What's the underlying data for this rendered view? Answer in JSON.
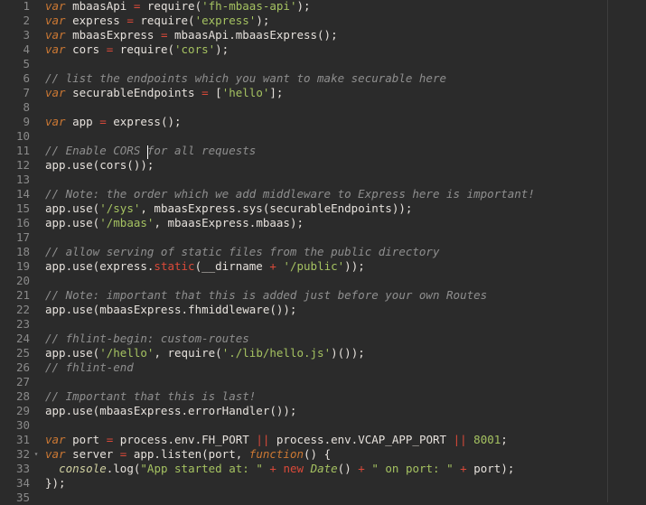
{
  "editor": {
    "theme": {
      "background": "#2b2b2b",
      "keyword": "#cc7833",
      "string": "#a5c261",
      "operator": "#da4939",
      "comment": "#b0b0b0"
    },
    "fold_icon": "fold-triangle-down-icon",
    "lines": [
      {
        "n": "1",
        "tokens": [
          [
            "kw",
            "var"
          ],
          [
            "t",
            " mbaasApi "
          ],
          [
            "op",
            "="
          ],
          [
            "t",
            " require("
          ],
          [
            "str",
            "'fh-mbaas-api'"
          ],
          [
            "t",
            ");"
          ]
        ]
      },
      {
        "n": "2",
        "tokens": [
          [
            "kw",
            "var"
          ],
          [
            "t",
            " express "
          ],
          [
            "op",
            "="
          ],
          [
            "t",
            " require("
          ],
          [
            "str",
            "'express'"
          ],
          [
            "t",
            ");"
          ]
        ]
      },
      {
        "n": "3",
        "tokens": [
          [
            "kw",
            "var"
          ],
          [
            "t",
            " mbaasExpress "
          ],
          [
            "op",
            "="
          ],
          [
            "t",
            " mbaasApi.mbaasExpress();"
          ]
        ]
      },
      {
        "n": "4",
        "tokens": [
          [
            "kw",
            "var"
          ],
          [
            "t",
            " cors "
          ],
          [
            "op",
            "="
          ],
          [
            "t",
            " require("
          ],
          [
            "str",
            "'cors'"
          ],
          [
            "t",
            ");"
          ]
        ]
      },
      {
        "n": "5",
        "tokens": []
      },
      {
        "n": "6",
        "tokens": [
          [
            "cm",
            "// list the endpoints which you want to make securable here"
          ]
        ]
      },
      {
        "n": "7",
        "tokens": [
          [
            "kw",
            "var"
          ],
          [
            "t",
            " securableEndpoints "
          ],
          [
            "op",
            "="
          ],
          [
            "t",
            " ["
          ],
          [
            "str",
            "'hello'"
          ],
          [
            "t",
            "];"
          ]
        ]
      },
      {
        "n": "8",
        "tokens": []
      },
      {
        "n": "9",
        "tokens": [
          [
            "kw",
            "var"
          ],
          [
            "t",
            " app "
          ],
          [
            "op",
            "="
          ],
          [
            "t",
            " express();"
          ]
        ]
      },
      {
        "n": "10",
        "tokens": []
      },
      {
        "n": "11",
        "tokens": [
          [
            "cm",
            "// Enable CORS for all requests"
          ]
        ]
      },
      {
        "n": "12",
        "tokens": [
          [
            "t",
            "app.use(cors());"
          ]
        ]
      },
      {
        "n": "13",
        "tokens": []
      },
      {
        "n": "14",
        "tokens": [
          [
            "cm",
            "// Note: the order which we add middleware to Express here is important!"
          ]
        ]
      },
      {
        "n": "15",
        "tokens": [
          [
            "t",
            "app.use("
          ],
          [
            "str",
            "'/sys'"
          ],
          [
            "t",
            ", mbaasExpress.sys(securableEndpoints));"
          ]
        ]
      },
      {
        "n": "16",
        "tokens": [
          [
            "t",
            "app.use("
          ],
          [
            "str",
            "'/mbaas'"
          ],
          [
            "t",
            ", mbaasExpress.mbaas);"
          ]
        ]
      },
      {
        "n": "17",
        "tokens": []
      },
      {
        "n": "18",
        "tokens": [
          [
            "cm",
            "// allow serving of static files from the public directory"
          ]
        ]
      },
      {
        "n": "19",
        "tokens": [
          [
            "t",
            "app.use(express."
          ],
          [
            "op",
            "static"
          ],
          [
            "t",
            "(__dirname "
          ],
          [
            "op",
            "+"
          ],
          [
            "t",
            " "
          ],
          [
            "str",
            "'/public'"
          ],
          [
            "t",
            "));"
          ]
        ]
      },
      {
        "n": "20",
        "tokens": []
      },
      {
        "n": "21",
        "tokens": [
          [
            "cm",
            "// Note: important that this is added just before your own Routes"
          ]
        ]
      },
      {
        "n": "22",
        "tokens": [
          [
            "t",
            "app.use(mbaasExpress.fhmiddleware());"
          ]
        ]
      },
      {
        "n": "23",
        "tokens": []
      },
      {
        "n": "24",
        "tokens": [
          [
            "cm",
            "// fhlint-begin: custom-routes"
          ]
        ]
      },
      {
        "n": "25",
        "tokens": [
          [
            "t",
            "app.use("
          ],
          [
            "str",
            "'/hello'"
          ],
          [
            "t",
            ", require("
          ],
          [
            "str",
            "'./lib/hello.js'"
          ],
          [
            "t",
            ")());"
          ]
        ]
      },
      {
        "n": "26",
        "tokens": [
          [
            "cm",
            "// fhlint-end"
          ]
        ]
      },
      {
        "n": "27",
        "tokens": []
      },
      {
        "n": "28",
        "tokens": [
          [
            "cm",
            "// Important that this is last!"
          ]
        ]
      },
      {
        "n": "29",
        "tokens": [
          [
            "t",
            "app.use(mbaasExpress.errorHandler());"
          ]
        ]
      },
      {
        "n": "30",
        "tokens": []
      },
      {
        "n": "31",
        "tokens": [
          [
            "kw",
            "var"
          ],
          [
            "t",
            " port "
          ],
          [
            "op",
            "="
          ],
          [
            "t",
            " process.env.FH_PORT "
          ],
          [
            "op",
            "||"
          ],
          [
            "t",
            " process.env.VCAP_APP_PORT "
          ],
          [
            "op",
            "||"
          ],
          [
            "t",
            " "
          ],
          [
            "num",
            "8001"
          ],
          [
            "t",
            ";"
          ]
        ]
      },
      {
        "n": "32",
        "fold": true,
        "tokens": [
          [
            "kw",
            "var"
          ],
          [
            "t",
            " server "
          ],
          [
            "op",
            "="
          ],
          [
            "t",
            " app.listen(port, "
          ],
          [
            "fn",
            "function"
          ],
          [
            "t",
            "() {"
          ]
        ]
      },
      {
        "n": "33",
        "tokens": [
          [
            "t",
            "  "
          ],
          [
            "obj",
            "console"
          ],
          [
            "t",
            ".log("
          ],
          [
            "str",
            "\"App started at: \""
          ],
          [
            "t",
            " "
          ],
          [
            "op",
            "+"
          ],
          [
            "t",
            " "
          ],
          [
            "op",
            "new"
          ],
          [
            "t",
            " "
          ],
          [
            "ct",
            "Date"
          ],
          [
            "t",
            "() "
          ],
          [
            "op",
            "+"
          ],
          [
            "t",
            " "
          ],
          [
            "str",
            "\" on port: \""
          ],
          [
            "t",
            " "
          ],
          [
            "op",
            "+"
          ],
          [
            "t",
            " port);"
          ]
        ]
      },
      {
        "n": "34",
        "tokens": [
          [
            "t",
            "});"
          ]
        ]
      },
      {
        "n": "35",
        "tokens": []
      }
    ]
  }
}
